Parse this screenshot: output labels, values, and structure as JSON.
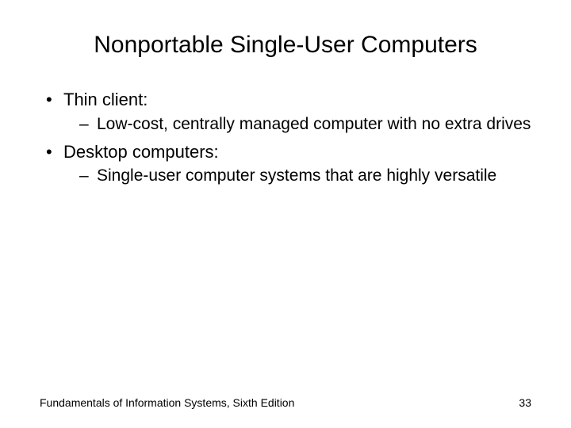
{
  "title": "Nonportable Single-User Computers",
  "bullets": [
    {
      "label": "Thin client:",
      "sub": [
        "Low-cost, centrally managed computer with no extra drives"
      ]
    },
    {
      "label": "Desktop computers:",
      "sub": [
        "Single-user computer systems that are highly versatile"
      ]
    }
  ],
  "footer": {
    "source": "Fundamentals of Information Systems, Sixth Edition",
    "page": "33"
  }
}
